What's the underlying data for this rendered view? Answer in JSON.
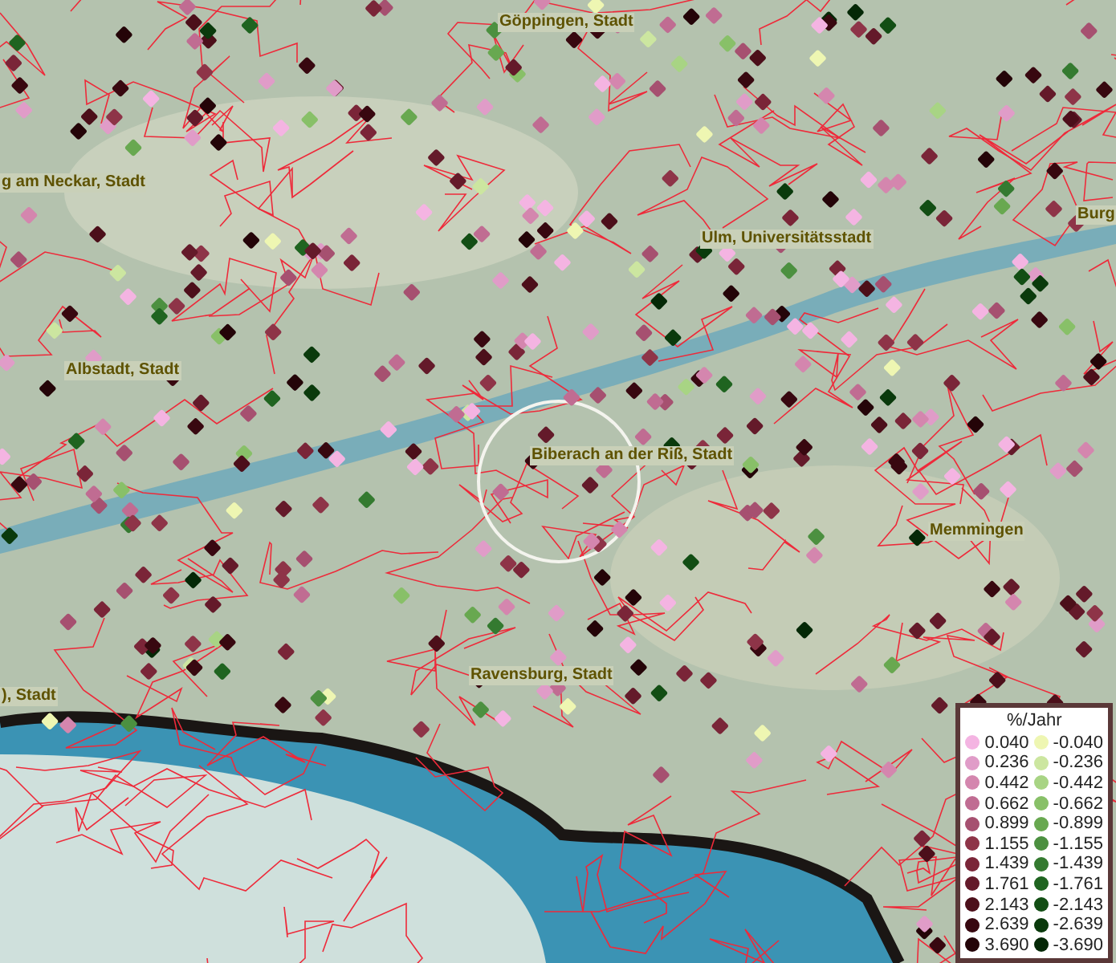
{
  "map": {
    "place_labels": [
      "Göppingen, Stadt",
      "g am Neckar, Stadt",
      "Ulm, Universitätsstadt",
      "Burg",
      "Albstadt, Stadt",
      "Biberach an der Riß, Stadt",
      "Memmingen",
      "), Stadt",
      "Ravensburg, Stadt"
    ]
  },
  "legend": {
    "title": "%/Jahr",
    "columns": [
      [
        {
          "label": "0.040",
          "color": "#f4b4e2"
        },
        {
          "label": "0.236",
          "color": "#e09cc8"
        },
        {
          "label": "0.442",
          "color": "#d486ae"
        },
        {
          "label": "0.662",
          "color": "#c06c92"
        },
        {
          "label": "0.899",
          "color": "#a65070"
        },
        {
          "label": "1.155",
          "color": "#8e3448"
        },
        {
          "label": "1.439",
          "color": "#7a2538"
        },
        {
          "label": "1.761",
          "color": "#641a2a"
        },
        {
          "label": "2.143",
          "color": "#4c0f1a"
        },
        {
          "label": "2.639",
          "color": "#380810"
        },
        {
          "label": "3.690",
          "color": "#240408"
        }
      ],
      [
        {
          "label": "-0.040",
          "color": "#eef6b2"
        },
        {
          "label": "-0.236",
          "color": "#cce6a0"
        },
        {
          "label": "-0.442",
          "color": "#a8d484"
        },
        {
          "label": "-0.662",
          "color": "#88c068"
        },
        {
          "label": "-0.899",
          "color": "#68a850"
        },
        {
          "label": "-1.155",
          "color": "#4c9040"
        },
        {
          "label": "-1.439",
          "color": "#347a30"
        },
        {
          "label": "-1.761",
          "color": "#1f6420"
        },
        {
          "label": "-2.143",
          "color": "#124e14"
        },
        {
          "label": "-2.639",
          "color": "#0a3a0c"
        },
        {
          "label": "-3.690",
          "color": "#042806"
        }
      ]
    ]
  }
}
